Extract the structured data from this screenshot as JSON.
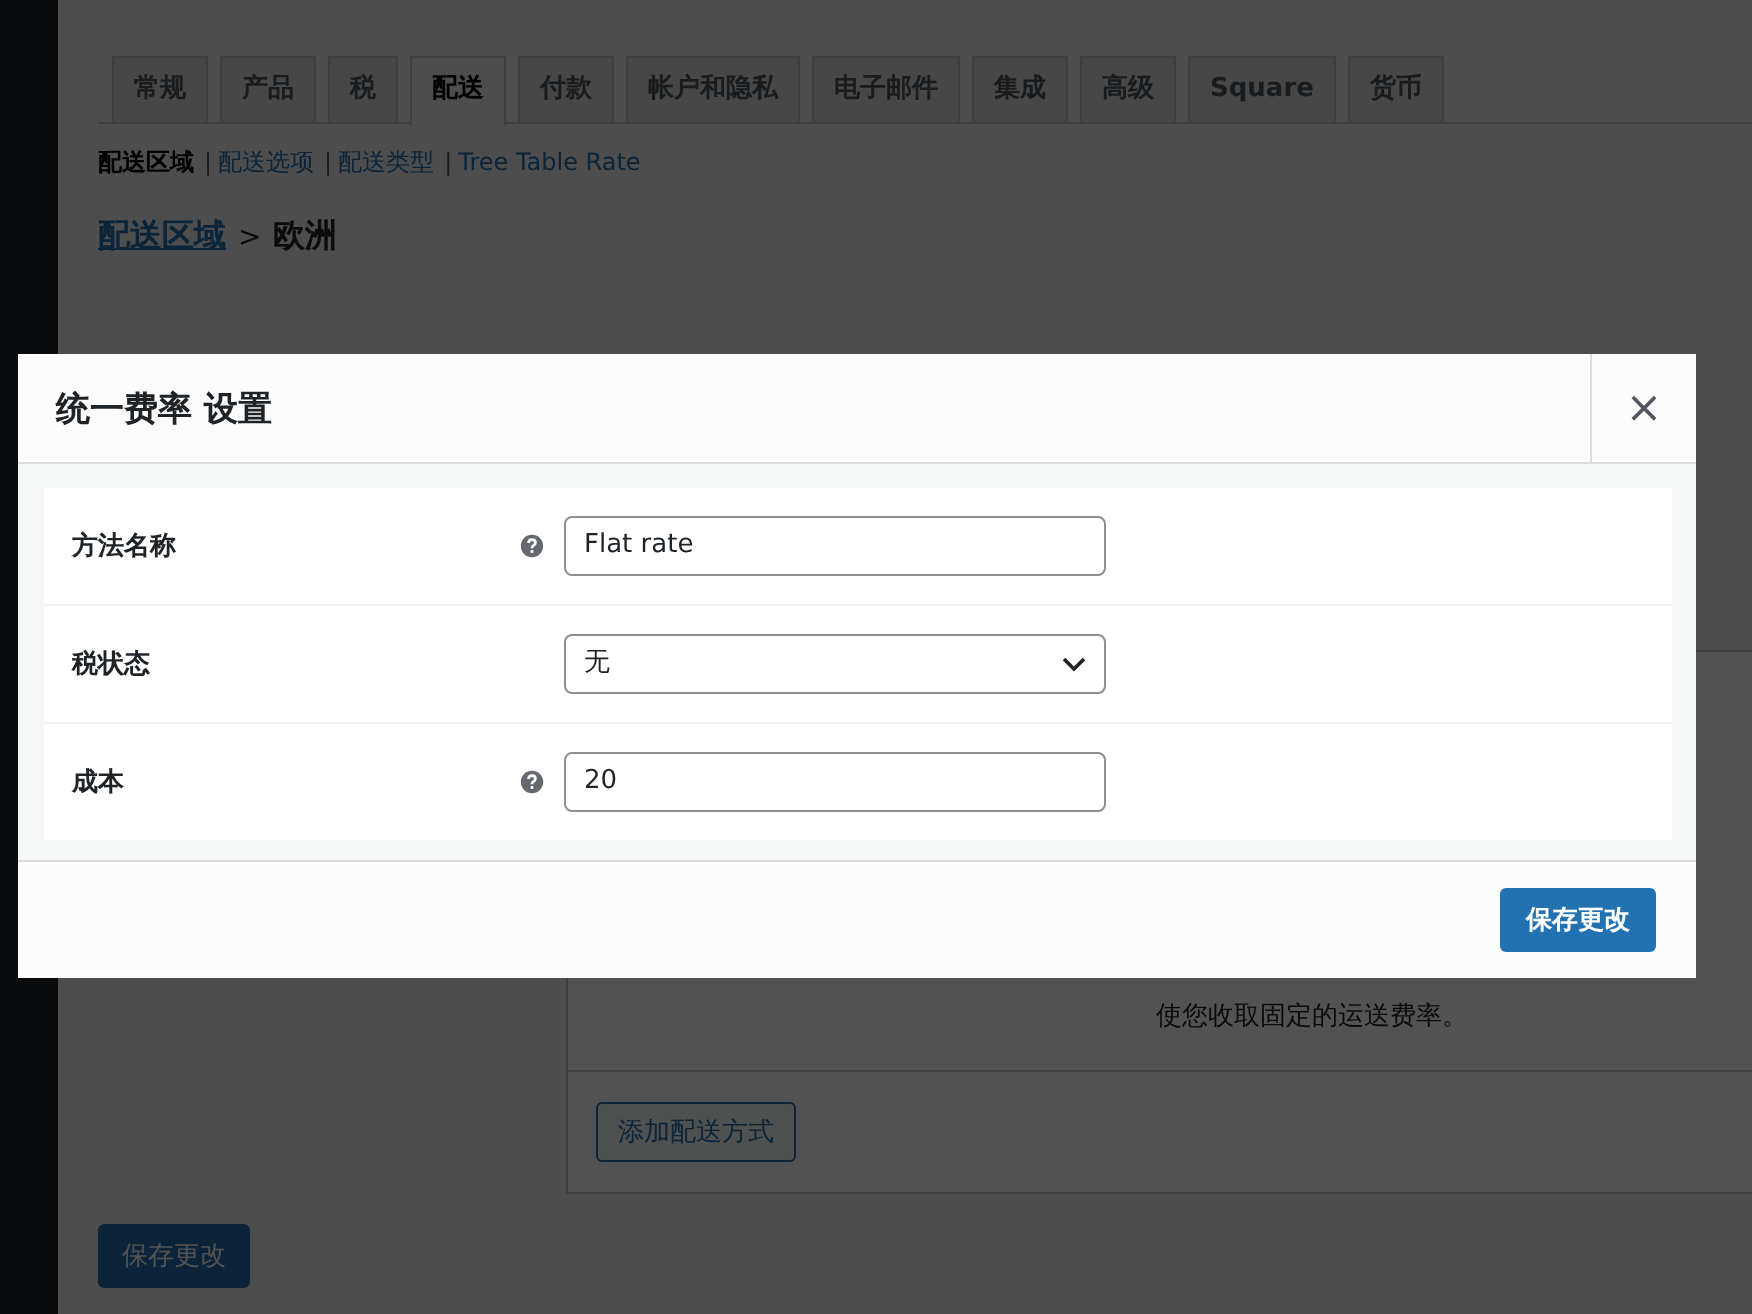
{
  "tabs": [
    {
      "label": "常规",
      "selected": false
    },
    {
      "label": "产品",
      "selected": false
    },
    {
      "label": "税",
      "selected": false
    },
    {
      "label": "配送",
      "selected": true
    },
    {
      "label": "付款",
      "selected": false
    },
    {
      "label": "帐户和隐私",
      "selected": false
    },
    {
      "label": "电子邮件",
      "selected": false
    },
    {
      "label": "集成",
      "selected": false
    },
    {
      "label": "高级",
      "selected": false
    },
    {
      "label": "Square",
      "selected": false
    },
    {
      "label": "货币",
      "selected": false
    }
  ],
  "subnav_separator": "|",
  "subnav": [
    {
      "label": "配送区域",
      "selected": true
    },
    {
      "label": "配送选项",
      "selected": false
    },
    {
      "label": "配送类型",
      "selected": false
    },
    {
      "label": "Tree Table Rate",
      "selected": false
    }
  ],
  "breadcrumb": {
    "link": "配送区域",
    "separator": ">",
    "current": "欧洲"
  },
  "methods_panel": {
    "description": "使您收取固定的运送费率。",
    "add_button": "添加配送方式"
  },
  "save_button": "保存更改",
  "modal": {
    "title": "统一费率 设置",
    "close": "×",
    "fields": [
      {
        "label": "方法名称",
        "help": true,
        "kind": "text",
        "value": "Flat rate"
      },
      {
        "label": "税状态",
        "help": false,
        "kind": "select",
        "value": "无"
      },
      {
        "label": "成本",
        "help": true,
        "kind": "text",
        "value": "20"
      }
    ],
    "save_button": "保存更改"
  }
}
